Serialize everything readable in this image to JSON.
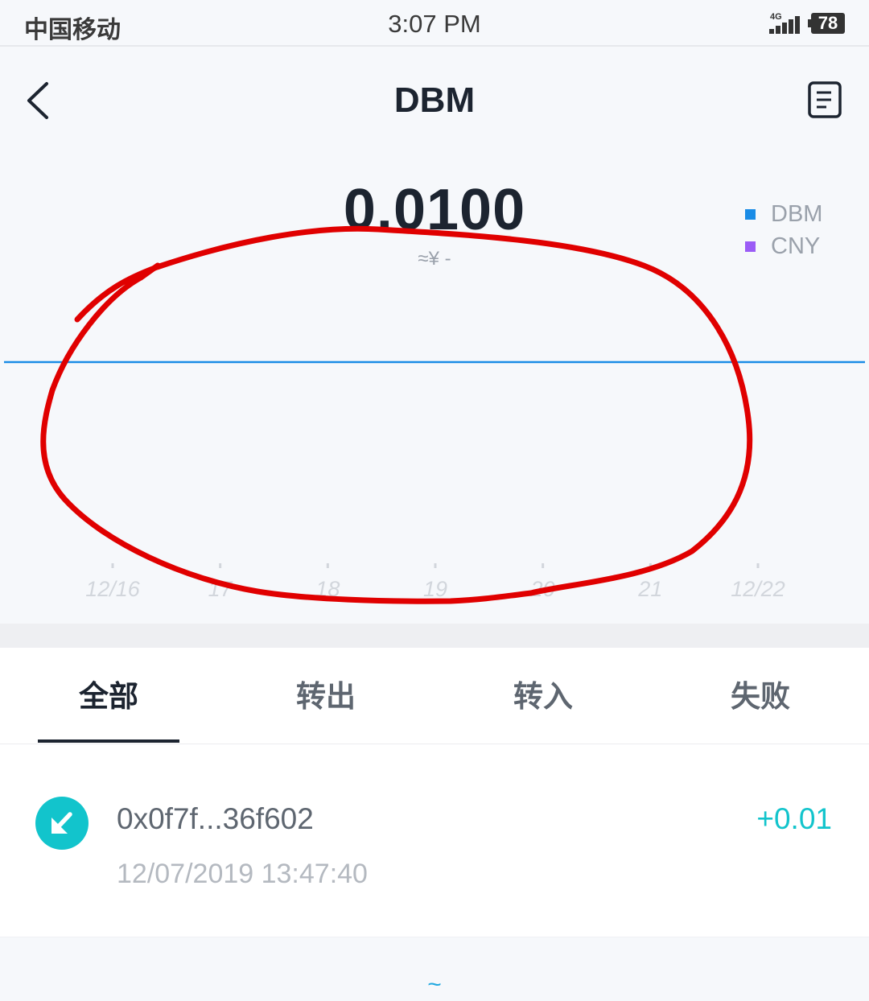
{
  "status_bar": {
    "carrier": "中国移动",
    "time": "3:07 PM",
    "network": "4G",
    "battery": "78"
  },
  "nav": {
    "title": "DBM",
    "back_icon": "chevron-left-icon",
    "records_icon": "document-list-icon"
  },
  "balance": {
    "amount": "0.0100",
    "fiat": "≈¥ -"
  },
  "legend": [
    {
      "label": "DBM",
      "color": "#1a8ce6"
    },
    {
      "label": "CNY",
      "color": "#9b5cf6"
    }
  ],
  "chart_data": {
    "type": "line",
    "x": [
      "12/16",
      "17",
      "18",
      "19",
      "20",
      "21",
      "12/22"
    ],
    "series": [
      {
        "name": "DBM",
        "values": [
          0.01,
          0.01,
          0.01,
          0.01,
          0.01,
          0.01,
          0.01
        ],
        "color": "#1a8ce6"
      }
    ],
    "legend": [
      "DBM",
      "CNY"
    ],
    "grid": false
  },
  "tabs": [
    {
      "label": "全部",
      "active": true
    },
    {
      "label": "转出",
      "active": false
    },
    {
      "label": "转入",
      "active": false
    },
    {
      "label": "失败",
      "active": false
    }
  ],
  "transactions": [
    {
      "icon": "incoming-arrow-icon",
      "address": "0x0f7f...36f602",
      "amount": "+0.01",
      "time": "12/07/2019 13:47:40"
    }
  ],
  "footer": {
    "indicator": "~"
  },
  "annotation_color": "#e00000"
}
